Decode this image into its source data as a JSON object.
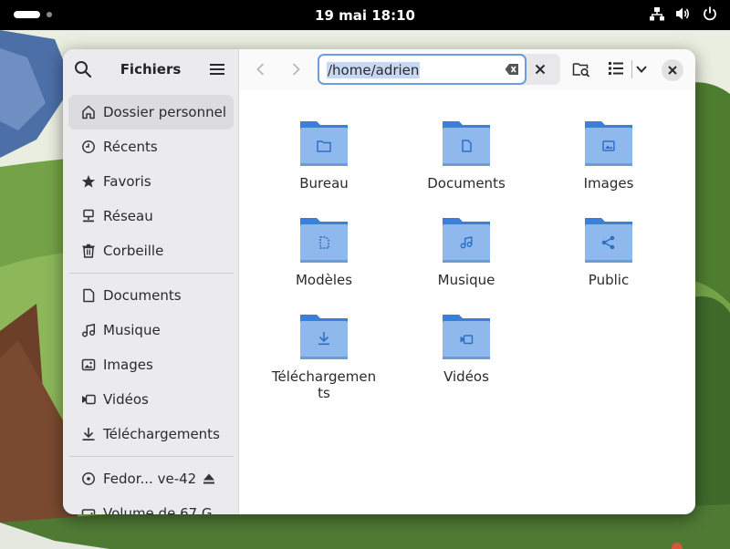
{
  "topbar": {
    "clock": "19 mai  18:10",
    "icons": [
      "network-icon",
      "volume-icon",
      "power-icon"
    ]
  },
  "window": {
    "app_title": "Fichiers",
    "path": "/home/adrien",
    "accent": "#6b9de1",
    "folder_color": "#8fb8ec"
  },
  "sidebar": {
    "places": [
      {
        "label": "Dossier personnel",
        "icon": "home-icon",
        "active": true
      },
      {
        "label": "Récents",
        "icon": "clock-icon"
      },
      {
        "label": "Favoris",
        "icon": "star-icon"
      },
      {
        "label": "Réseau",
        "icon": "network-icon"
      },
      {
        "label": "Corbeille",
        "icon": "trash-icon"
      }
    ],
    "bookmarks": [
      {
        "label": "Documents",
        "icon": "document-icon"
      },
      {
        "label": "Musique",
        "icon": "music-icon"
      },
      {
        "label": "Images",
        "icon": "image-icon"
      },
      {
        "label": "Vidéos",
        "icon": "video-icon"
      },
      {
        "label": "Téléchargements",
        "icon": "download-icon"
      }
    ],
    "devices": [
      {
        "label": "Fedor... ve-42",
        "icon": "disc-icon"
      },
      {
        "label": "Volume de 67 G",
        "icon": "drive-icon"
      }
    ]
  },
  "folders": [
    {
      "name": "Bureau",
      "emblem": "folder-emblem-icon"
    },
    {
      "name": "Documents",
      "emblem": "document-icon"
    },
    {
      "name": "Images",
      "emblem": "image-icon"
    },
    {
      "name": "Modèles",
      "emblem": "template-icon"
    },
    {
      "name": "Musique",
      "emblem": "music-icon"
    },
    {
      "name": "Public",
      "emblem": "share-icon"
    },
    {
      "name": "Téléchargements",
      "emblem": "download-icon"
    },
    {
      "name": "Vidéos",
      "emblem": "video-icon"
    }
  ]
}
